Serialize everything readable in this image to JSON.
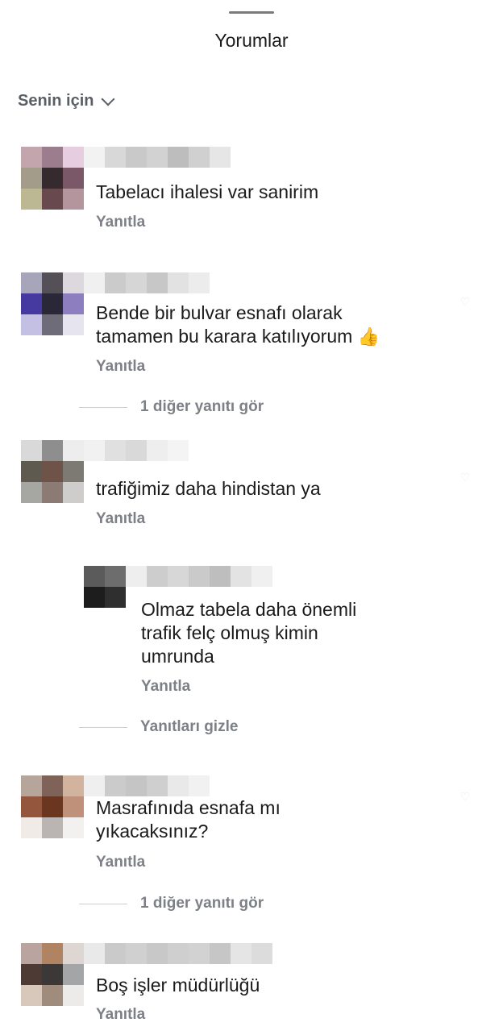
{
  "header": {
    "title": "Yorumlar"
  },
  "filter": {
    "label": "Senin için",
    "icon": "chevron-down-icon"
  },
  "comments": [
    {
      "text": "Tabelacı ihalesi var sanirim",
      "reply_label": "Yanıtla"
    },
    {
      "text_line1": "Bende bir bulvar esnafı olarak",
      "text_line2": "tamamen bu karara katılıyorum",
      "emoji": "👍",
      "reply_label": "Yanıtla",
      "more_replies": "1 diğer yanıtı gör"
    },
    {
      "text": "trafiğimiz daha hindistan ya",
      "reply_label": "Yanıtla"
    },
    {
      "text_line1": "Olmaz tabela daha önemli",
      "text_line2": "trafik felç olmuş kimin",
      "text_line3": "umrunda",
      "reply_label": "Yanıtla",
      "hide_replies": "Yanıtları gizle"
    },
    {
      "text_line1": "Masrafınıda esnafa mı",
      "text_line2": "yıkacaksınız?",
      "reply_label": "Yanıtla",
      "more_replies": "1 diğer yanıtı gör"
    },
    {
      "text": "Boş işler müdürlüğü",
      "reply_label": "Yanıtla"
    }
  ]
}
